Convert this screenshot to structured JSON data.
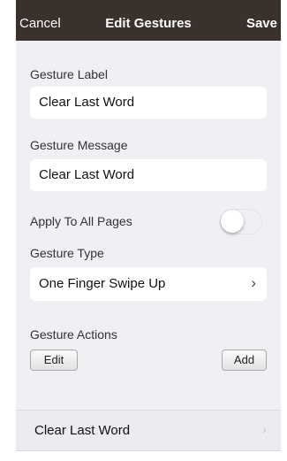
{
  "navbar": {
    "cancel_label": "Cancel",
    "title": "Edit Gestures",
    "save_label": "Save"
  },
  "gesture_label": {
    "label": "Gesture Label",
    "value": "Clear Last Word"
  },
  "gesture_message": {
    "label": "Gesture Message",
    "value": "Clear Last Word"
  },
  "apply_all_pages": {
    "label": "Apply To All Pages",
    "on": false
  },
  "gesture_type": {
    "label": "Gesture Type",
    "value": "One Finger Swipe Up",
    "chevron": "›"
  },
  "gesture_actions": {
    "label": "Gesture Actions",
    "edit_label": "Edit",
    "add_label": "Add",
    "items": [
      {
        "label": "Clear Last Word",
        "chevron": "›"
      }
    ]
  },
  "colors": {
    "navbar_bg": "#3a302c",
    "panel_bg": "#efeff4",
    "field_bg": "#ffffff"
  },
  "icons": {
    "type_chevron": "chevron-right-icon",
    "action_chevron": "chevron-right-icon"
  }
}
